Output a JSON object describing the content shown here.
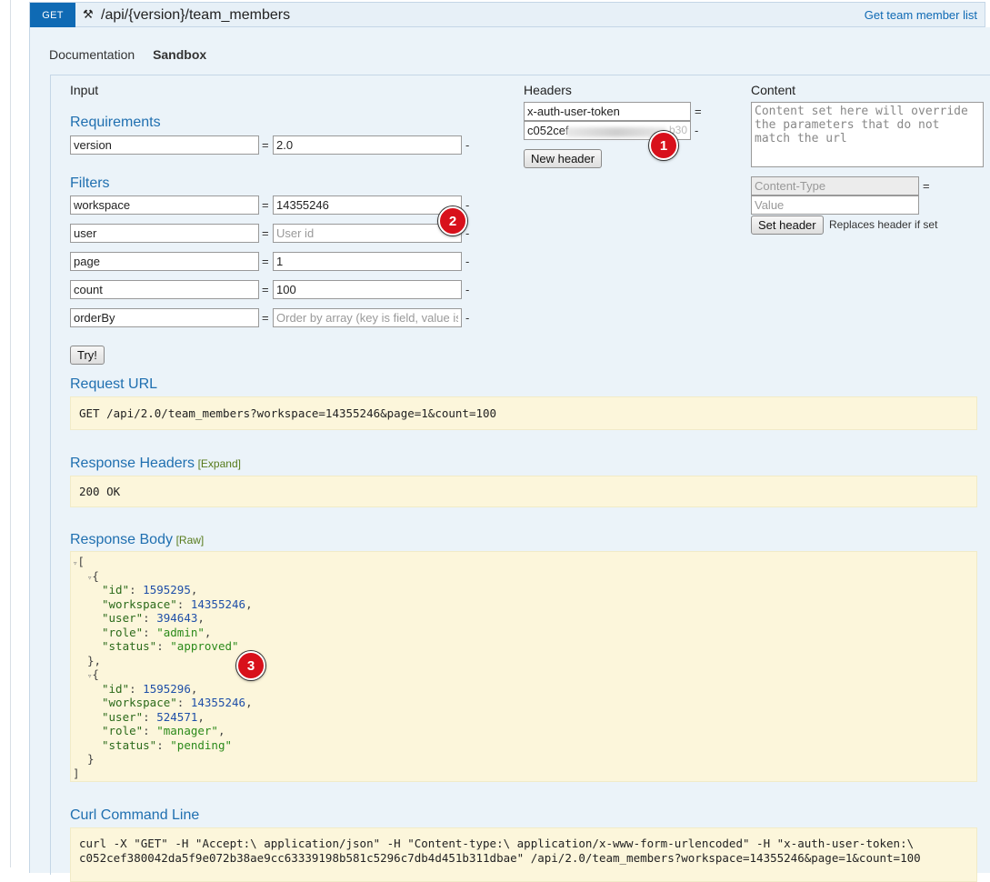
{
  "header": {
    "method": "GET",
    "path": "/api/{version}/team_members",
    "summary": "Get team member list"
  },
  "tabs": [
    {
      "label": "Documentation"
    },
    {
      "label": "Sandbox"
    }
  ],
  "input": {
    "title": "Input",
    "requirements_title": "Requirements",
    "requirements": [
      {
        "name": "version",
        "value": "2.0",
        "placeholder": ""
      }
    ],
    "filters_title": "Filters",
    "filters": [
      {
        "name": "workspace",
        "value": "14355246",
        "placeholder": ""
      },
      {
        "name": "user",
        "value": "",
        "placeholder": "User id"
      },
      {
        "name": "page",
        "value": "1",
        "placeholder": ""
      },
      {
        "name": "count",
        "value": "100",
        "placeholder": ""
      },
      {
        "name": "orderBy",
        "value": "",
        "placeholder": "Order by array (key is field, value is direction)"
      }
    ],
    "try_label": "Try!"
  },
  "headers": {
    "title": "Headers",
    "name_value": "x-auth-user-token",
    "value_value": "c052cef",
    "value_tail": "b30",
    "new_header_label": "New header"
  },
  "content": {
    "title": "Content",
    "placeholder": "Content set here will override the parameters that do not match the url",
    "content_type_placeholder": "Content-Type",
    "value_placeholder": "Value",
    "set_header_label": "Set header",
    "replaces_hint": "Replaces header if set"
  },
  "eq": "=",
  "dash": "-",
  "request_url": {
    "title": "Request URL",
    "text": "GET /api/2.0/team_members?workspace=14355246&page=1&count=100"
  },
  "response_headers": {
    "title": "Response Headers",
    "expand": "[Expand]",
    "text": "200 OK"
  },
  "response_body": {
    "title": "Response Body",
    "raw": "[Raw]",
    "items": [
      {
        "id": "1595295",
        "workspace": "14355246",
        "user": "394643",
        "role": "\"admin\"",
        "status": "\"approved\""
      },
      {
        "id": "1595296",
        "workspace": "14355246",
        "user": "524571",
        "role": "\"manager\"",
        "status": "\"pending\""
      }
    ]
  },
  "curl": {
    "title": "Curl Command Line",
    "line1": "curl -X \"GET\" -H \"Accept:\\ application/json\" -H \"Content-type:\\ application/x-www-form-urlencoded\" -H \"x-auth-user-token:\\",
    "line2": "c052cef380042da5f9e072b38ae9cc63339198b581c5296c7db4d451b311dbae\" /api/2.0/team_members?workspace=14355246&page=1&count=100"
  },
  "markers": [
    "1",
    "2",
    "3"
  ]
}
